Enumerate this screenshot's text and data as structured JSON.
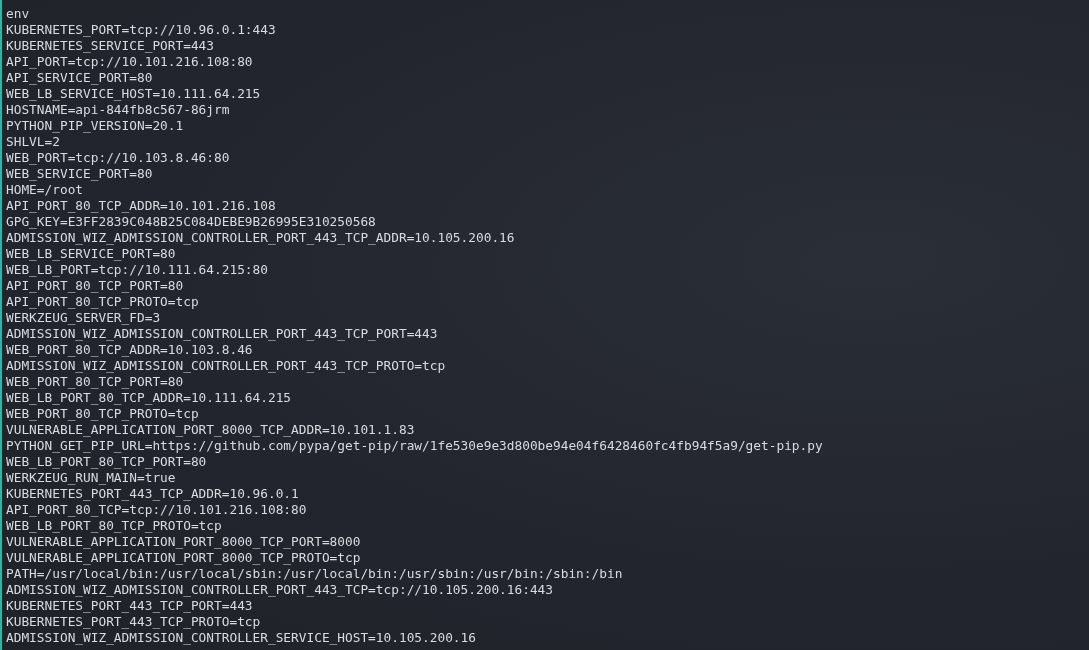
{
  "terminal": {
    "lines": [
      "env",
      "KUBERNETES_PORT=tcp://10.96.0.1:443",
      "KUBERNETES_SERVICE_PORT=443",
      "API_PORT=tcp://10.101.216.108:80",
      "API_SERVICE_PORT=80",
      "WEB_LB_SERVICE_HOST=10.111.64.215",
      "HOSTNAME=api-844fb8c567-86jrm",
      "PYTHON_PIP_VERSION=20.1",
      "SHLVL=2",
      "WEB_PORT=tcp://10.103.8.46:80",
      "WEB_SERVICE_PORT=80",
      "HOME=/root",
      "API_PORT_80_TCP_ADDR=10.101.216.108",
      "GPG_KEY=E3FF2839C048B25C084DEBE9B26995E310250568",
      "ADMISSION_WIZ_ADMISSION_CONTROLLER_PORT_443_TCP_ADDR=10.105.200.16",
      "WEB_LB_SERVICE_PORT=80",
      "WEB_LB_PORT=tcp://10.111.64.215:80",
      "API_PORT_80_TCP_PORT=80",
      "API_PORT_80_TCP_PROTO=tcp",
      "WERKZEUG_SERVER_FD=3",
      "ADMISSION_WIZ_ADMISSION_CONTROLLER_PORT_443_TCP_PORT=443",
      "WEB_PORT_80_TCP_ADDR=10.103.8.46",
      "ADMISSION_WIZ_ADMISSION_CONTROLLER_PORT_443_TCP_PROTO=tcp",
      "WEB_PORT_80_TCP_PORT=80",
      "WEB_LB_PORT_80_TCP_ADDR=10.111.64.215",
      "WEB_PORT_80_TCP_PROTO=tcp",
      "VULNERABLE_APPLICATION_PORT_8000_TCP_ADDR=10.101.1.83",
      "PYTHON_GET_PIP_URL=https://github.com/pypa/get-pip/raw/1fe530e9e3d800be94e04f6428460fc4fb94f5a9/get-pip.py",
      "WEB_LB_PORT_80_TCP_PORT=80",
      "WERKZEUG_RUN_MAIN=true",
      "KUBERNETES_PORT_443_TCP_ADDR=10.96.0.1",
      "API_PORT_80_TCP=tcp://10.101.216.108:80",
      "WEB_LB_PORT_80_TCP_PROTO=tcp",
      "VULNERABLE_APPLICATION_PORT_8000_TCP_PORT=8000",
      "VULNERABLE_APPLICATION_PORT_8000_TCP_PROTO=tcp",
      "PATH=/usr/local/bin:/usr/local/sbin:/usr/local/bin:/usr/sbin:/usr/bin:/sbin:/bin",
      "ADMISSION_WIZ_ADMISSION_CONTROLLER_PORT_443_TCP=tcp://10.105.200.16:443",
      "KUBERNETES_PORT_443_TCP_PORT=443",
      "KUBERNETES_PORT_443_TCP_PROTO=tcp",
      "ADMISSION_WIZ_ADMISSION_CONTROLLER_SERVICE_HOST=10.105.200.16"
    ]
  }
}
